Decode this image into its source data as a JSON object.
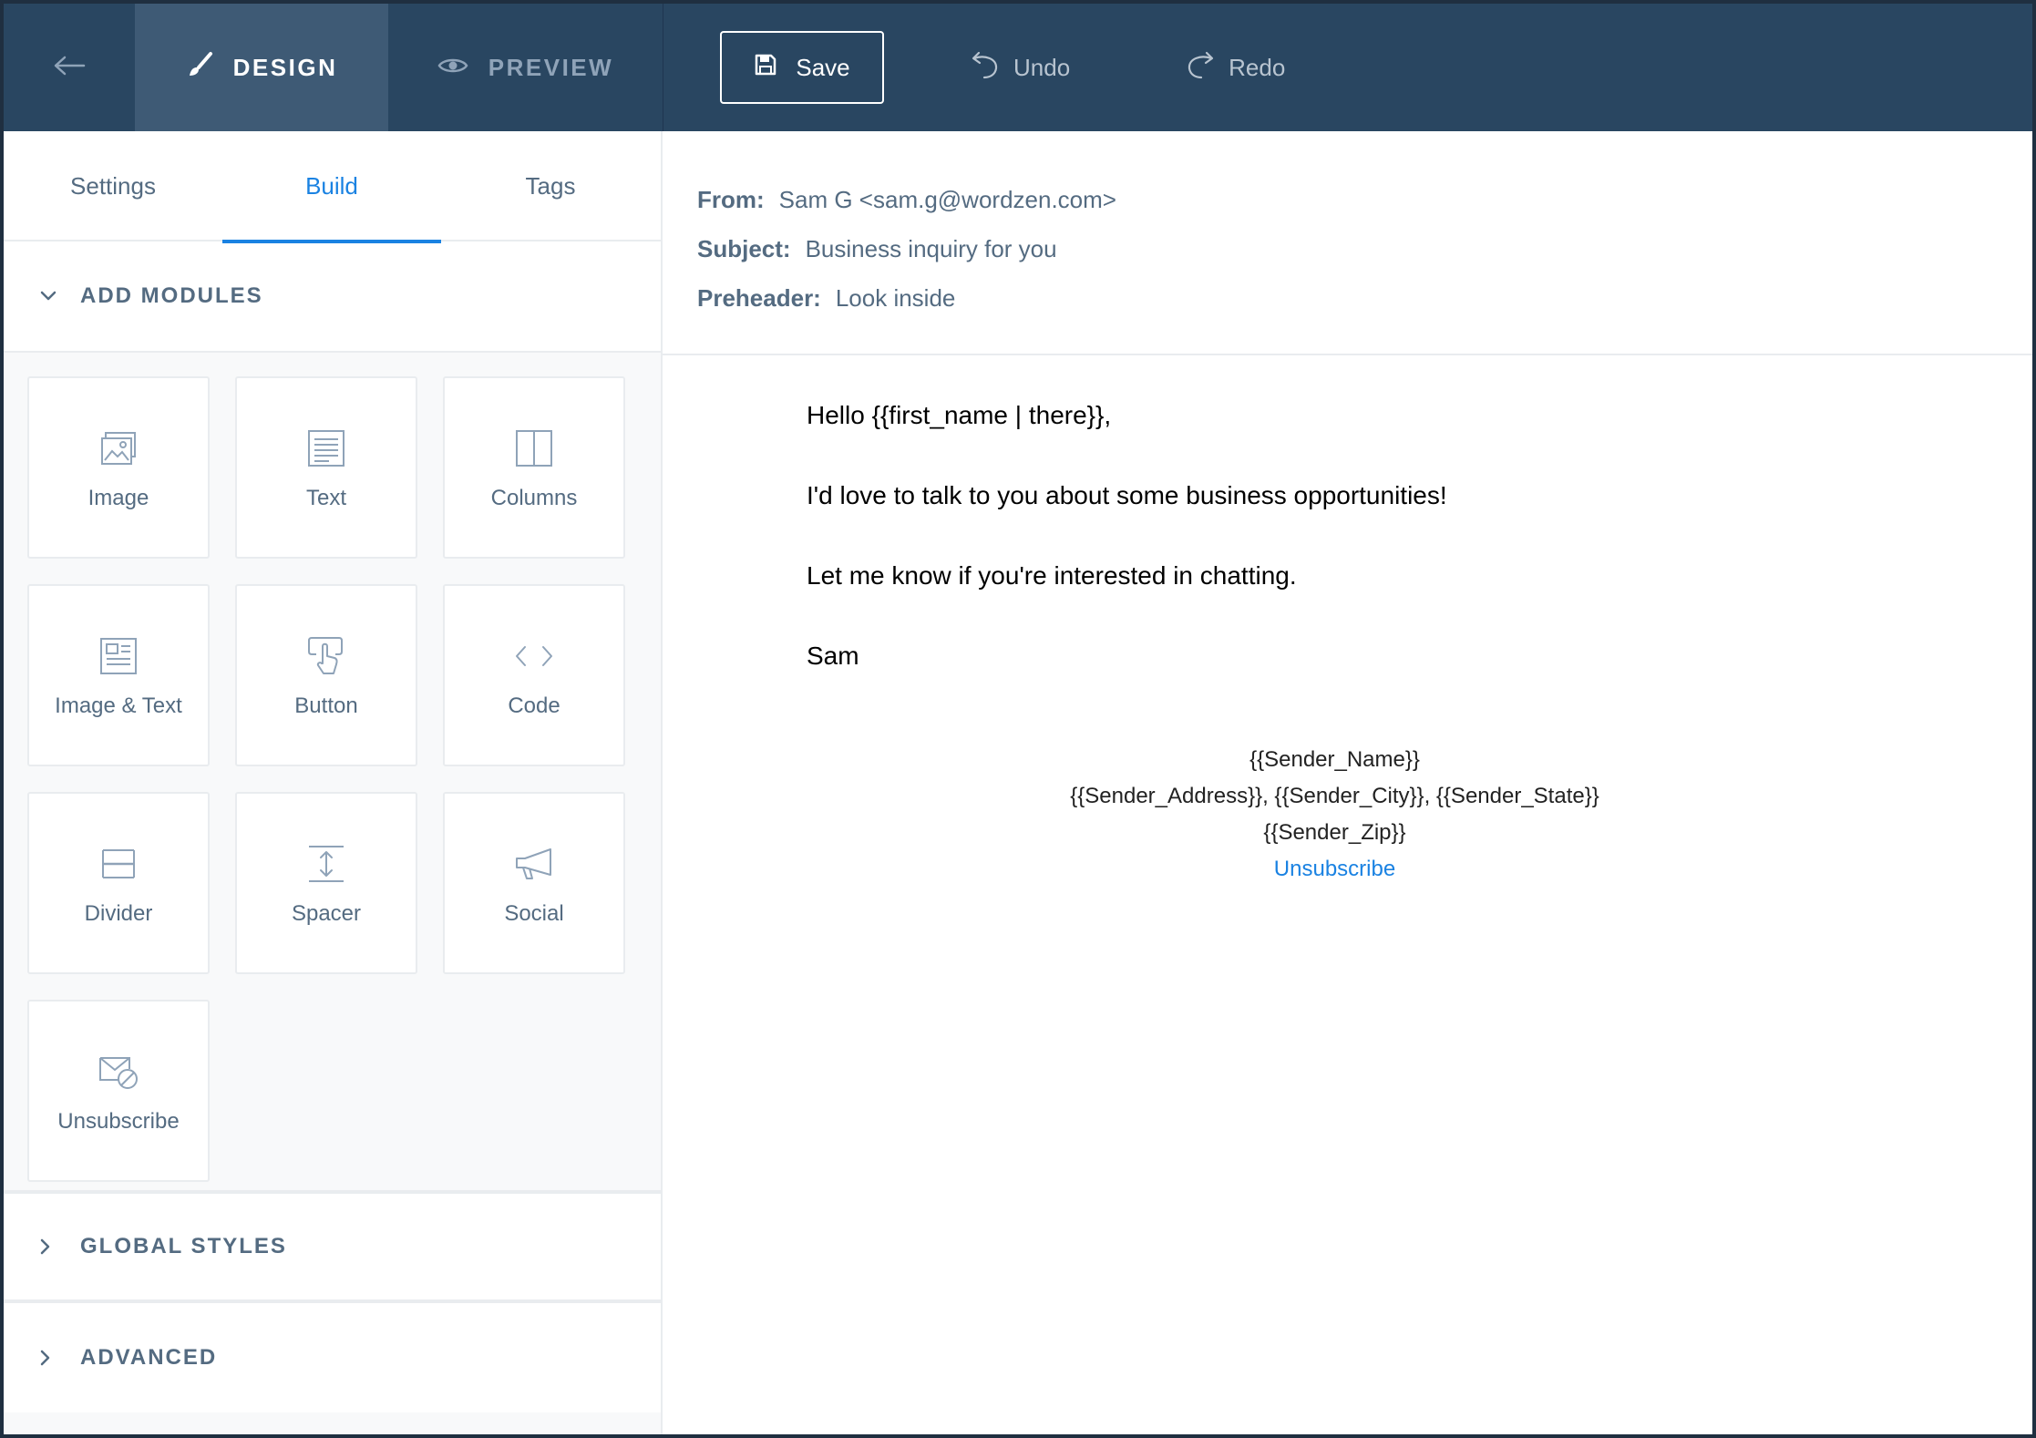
{
  "topbar": {
    "design_label": "DESIGN",
    "preview_label": "PREVIEW",
    "save_label": "Save",
    "undo_label": "Undo",
    "redo_label": "Redo",
    "icons": [
      "back-arrow-icon",
      "brush-icon",
      "eye-icon",
      "floppy-disk-icon",
      "undo-icon",
      "redo-icon"
    ]
  },
  "sidebar": {
    "tabs": [
      {
        "label": "Settings",
        "active": false
      },
      {
        "label": "Build",
        "active": true
      },
      {
        "label": "Tags",
        "active": false
      }
    ],
    "add_modules_label": "ADD MODULES",
    "modules": [
      {
        "label": "Image",
        "icon": "image-icon"
      },
      {
        "label": "Text",
        "icon": "text-icon"
      },
      {
        "label": "Columns",
        "icon": "columns-icon"
      },
      {
        "label": "Image & Text",
        "icon": "image-text-icon"
      },
      {
        "label": "Button",
        "icon": "button-pointer-icon"
      },
      {
        "label": "Code",
        "icon": "code-icon"
      },
      {
        "label": "Divider",
        "icon": "divider-icon"
      },
      {
        "label": "Spacer",
        "icon": "spacer-icon"
      },
      {
        "label": "Social",
        "icon": "megaphone-icon"
      },
      {
        "label": "Unsubscribe",
        "icon": "unsubscribe-envelope-icon"
      }
    ],
    "global_styles_label": "GLOBAL STYLES",
    "advanced_label": "ADVANCED"
  },
  "email": {
    "from_label": "From:",
    "from_value": "Sam G <sam.g@wordzen.com>",
    "subject_label": "Subject:",
    "subject_value": "Business inquiry for you",
    "preheader_label": "Preheader:",
    "preheader_value": "Look inside",
    "body": [
      "Hello {{first_name | there}},",
      "I'd love to talk to you about some business opportunities!",
      "Let me know if you're interested in chatting.",
      "Sam"
    ],
    "footer_name": "{{Sender_Name}}",
    "footer_address": "{{Sender_Address}}, {{Sender_City}}, {{Sender_State}} {{Sender_Zip}}",
    "unsubscribe_link": "Unsubscribe"
  },
  "colors": {
    "topbar": "#294661",
    "active_mode": "#3e5a75",
    "accent": "#1a82e2",
    "muted_text": "#546b81"
  }
}
